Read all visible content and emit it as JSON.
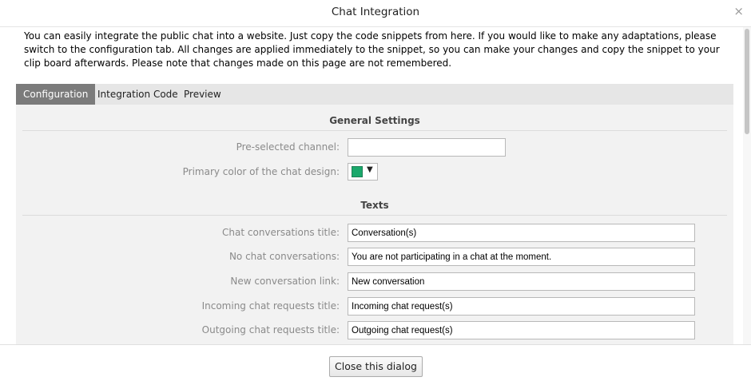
{
  "dialog": {
    "title": "Chat Integration",
    "close_glyph": "×",
    "intro": "You can easily integrate the public chat into a website. Just copy the code snippets from here. If you would like to make any adaptations, please switch to the configuration tab. All changes are applied immediately to the snippet, so you can make your changes and copy the snippet to your clip board afterwards. Please note that changes made on this page are not remembered."
  },
  "tabs": [
    {
      "label": "Configuration",
      "active": true
    },
    {
      "label": "Integration Code",
      "active": false
    },
    {
      "label": "Preview",
      "active": false
    }
  ],
  "general_settings": {
    "title": "General Settings",
    "preselected_channel": {
      "label": "Pre-selected channel:",
      "value": ""
    },
    "primary_color": {
      "label": "Primary color of the chat design:",
      "value": "#1aa86b"
    }
  },
  "texts": {
    "title": "Texts",
    "fields": [
      {
        "label": "Chat conversations title:",
        "value": "Conversation(s)"
      },
      {
        "label": "No chat conversations:",
        "value": "You are not participating in a chat at the moment."
      },
      {
        "label": "New conversation link:",
        "value": "New conversation"
      },
      {
        "label": "Incoming chat requests title:",
        "value": "Incoming chat request(s)"
      },
      {
        "label": "Outgoing chat requests title:",
        "value": "Outgoing chat request(s)"
      }
    ]
  },
  "footer": {
    "close_label": "Close this dialog"
  },
  "icons": {
    "close": "close-icon",
    "dropdown": "chevron-down-icon"
  },
  "colors": {
    "active_tab": "#7b7b7b",
    "tab_bar": "#e6e6e6",
    "panel": "#f2f2f2"
  }
}
